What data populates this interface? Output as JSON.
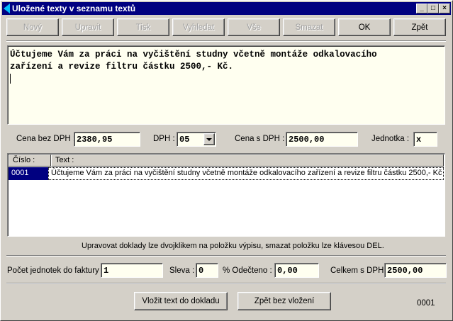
{
  "window": {
    "title": "Uložené texty v seznamu textů",
    "controls": [
      "_",
      "□",
      "×"
    ]
  },
  "toolbar": [
    {
      "label": "Nový",
      "enabled": false
    },
    {
      "label": "Upravit",
      "enabled": false
    },
    {
      "label": "Tisk",
      "enabled": false
    },
    {
      "label": "Vyhledat",
      "enabled": false
    },
    {
      "label": "Vše",
      "enabled": false
    },
    {
      "label": "Smazat",
      "enabled": false
    },
    {
      "label": "OK",
      "enabled": true
    },
    {
      "label": "Zpět",
      "enabled": true
    }
  ],
  "editor": {
    "text": "Účtujeme Vám za práci na vyčištění studny včetně montáže odkalovacího\nzařízení a revize filtru částku 2500,- Kč."
  },
  "price_row": {
    "cena_bez_dph_label": "Cena bez DPH :",
    "cena_bez_dph_value": "2380,95",
    "dph_label": "DPH :",
    "dph_value": "05",
    "cena_s_dph_label": "Cena s DPH :",
    "cena_s_dph_value": "2500,00",
    "jednotka_label": "Jednotka :",
    "jednotka_value": "x"
  },
  "list": {
    "columns": [
      "Číslo :",
      "Text :"
    ],
    "rows": [
      {
        "cislo": "0001",
        "text": "Účtujeme Vám za práci na vyčištění studny včetně montáže odkalovacího zařízení a revize filtru částku 2500,- Kč",
        "selected": true
      }
    ]
  },
  "hint": "Upravovat doklady lze dvojklikem na položku výpisu, smazat položku lze klávesou DEL.",
  "bottom_row": {
    "pocet_label": "Počet jednotek do faktury :",
    "pocet_value": "1",
    "sleva_label": "Sleva :",
    "sleva_value": "0",
    "odecteno_label": "% Odečteno :",
    "odecteno_value": "0,00",
    "celkem_label": "Celkem s DPH:",
    "celkem_value": "2500,00"
  },
  "footer": {
    "insert_button": "Vložit text do dokladu",
    "back_button": "Zpět bez vložení",
    "record_number": "0001"
  },
  "colors": {
    "titlebar": "#000080",
    "face": "#d4d0c8",
    "field_yellow": "#fffff0",
    "selection": "#000080"
  }
}
